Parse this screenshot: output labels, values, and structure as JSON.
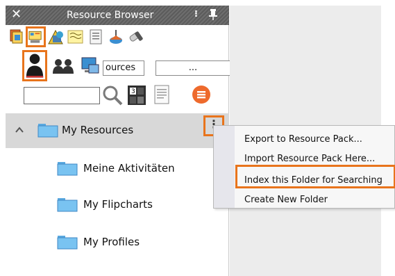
{
  "panel": {
    "title": "Resource Browser",
    "close_glyph": "✕",
    "menu_glyph": "⁝",
    "pin_icon": "pin-icon"
  },
  "toolbar": {
    "row1_icons": [
      "resources-icon",
      "flipchart-library-icon",
      "shapes-icon",
      "annotations-icon",
      "page-icon",
      "pages-lesson-icon",
      "tools-icon"
    ],
    "row2_icons": [
      "my-resources-icon",
      "shared-resources-icon",
      "computer-icon"
    ],
    "location_field": "ources",
    "browse_button_label": "...",
    "search_placeholder": "",
    "search_icon": "search-icon",
    "numbers_icon": "calculator-icon",
    "notes_icon": "notes-icon",
    "options_icon": "options-icon"
  },
  "tree": {
    "root": {
      "label": "My Resources",
      "expanded": true,
      "selected": true
    },
    "children": [
      {
        "label": "Meine Aktivitäten"
      },
      {
        "label": "My Flipcharts"
      },
      {
        "label": "My Profiles"
      }
    ],
    "more_glyph": "⋮"
  },
  "context_menu": {
    "items": [
      {
        "label": "Export to Resource Pack..."
      },
      {
        "label": "Import Resource Pack Here..."
      },
      {
        "label": "Index this Folder for Searching"
      },
      {
        "label": "Create New Folder"
      }
    ]
  },
  "colors": {
    "highlight": "#e8741c",
    "titlebar": "#666666",
    "selected_row": "#d8d8d8",
    "folder": "#79c3f1"
  }
}
